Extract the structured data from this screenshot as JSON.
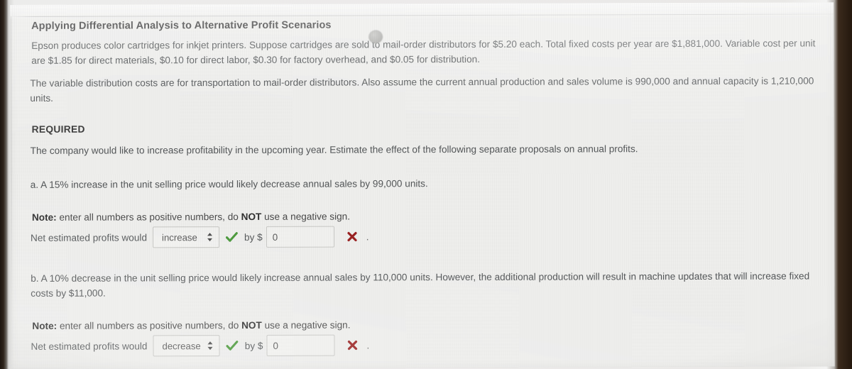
{
  "question": {
    "title": "Applying Differential Analysis to Alternative Profit Scenarios",
    "paragraph_1": "Epson produces color cartridges for inkjet printers. Suppose cartridges are sold to mail-order distributors for $5.20 each. Total fixed costs per year are $1,881,000. Variable cost per unit are $1.85 for direct materials, $0.10 for direct labor, $0.30 for factory overhead, and $0.05 for distribution.",
    "paragraph_2": "The variable distribution costs are for transportation to mail-order distributors. Also assume the current annual production and sales volume is 990,000 and annual capacity is 1,210,000 units.",
    "required_heading": "REQUIRED",
    "required_intro": "The company would like to increase profitability in the upcoming year. Estimate the effect of the following separate proposals on annual profits."
  },
  "parts": [
    {
      "prompt": "a. A 15% increase in the unit selling price would likely decrease annual sales by 99,000 units.",
      "note_prefix": "Note:",
      "note_text_1": " enter all numbers as positive numbers, do ",
      "note_bold": "NOT",
      "note_text_2": " use a negative sign.",
      "answer_label": "Net estimated profits would",
      "direction_value": "increase",
      "direction_options": [
        "increase",
        "decrease"
      ],
      "direction_status": "correct",
      "by_label": "by $",
      "amount_value": "0",
      "amount_placeholder": "",
      "amount_status": "incorrect",
      "trailing": "."
    },
    {
      "prompt": "b. A 10% decrease in the unit selling price would likely increase annual sales by 110,000 units. However, the additional production will result in machine updates that will increase fixed costs by $11,000.",
      "note_prefix": "Note:",
      "note_text_1": " enter all numbers as positive numbers, do ",
      "note_bold": "NOT",
      "note_text_2": " use a negative sign.",
      "answer_label": "Net estimated profits would",
      "direction_value": "decrease",
      "direction_options": [
        "increase",
        "decrease"
      ],
      "direction_status": "correct",
      "by_label": "by $",
      "amount_value": "0",
      "amount_placeholder": "",
      "amount_status": "incorrect",
      "trailing": "."
    }
  ],
  "colors": {
    "page_background": "#f1f1ef",
    "text": "#55585a",
    "heading": "#3b3b3b",
    "correct_green": "#4a9a3a",
    "incorrect_red": "#9c2222",
    "field_border": "#c9c9c6",
    "field_background": "#f4f4f2"
  }
}
